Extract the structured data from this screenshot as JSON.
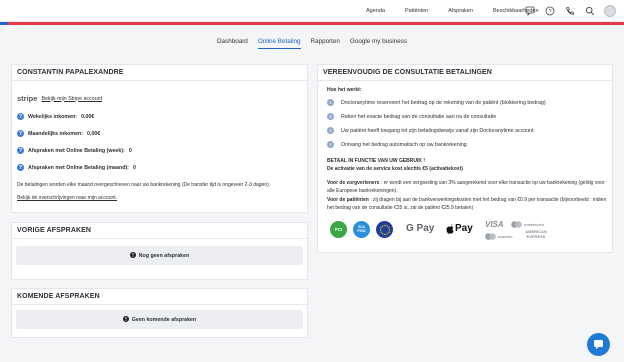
{
  "topnav": [
    "Agenda",
    "Patiënten",
    "Afspraken",
    "Beschikbaarheden"
  ],
  "tabs": [
    {
      "label": "Dashboard",
      "active": false
    },
    {
      "label": "Online Betaling",
      "active": true
    },
    {
      "label": "Rapporten",
      "active": false
    },
    {
      "label": "Google my business",
      "active": false
    }
  ],
  "account": {
    "name": "CONSTANTIN PAPALEXANDRE",
    "stripe_logo": "stripe",
    "stripe_link": "Bekijk mijn Stripe account",
    "stats": [
      {
        "label": "Wekelijks inkomen:",
        "value": "0,00€"
      },
      {
        "label": "Maandelijks inkomen:",
        "value": "0,00€"
      },
      {
        "label": "Afspraken met Online Betaling (week):",
        "value": "0"
      },
      {
        "label": "Afspraken met Online Betaling (maand):",
        "value": "0"
      }
    ],
    "note": "De betalingen worden elke maand overgeschreven naar uw bankrekening (De transfer tijd is ongeveer 2-3 dagen).",
    "transfers_link": "Bekijk de overschrijvingen naar mijn account."
  },
  "previous": {
    "title": "VORIGE AFSPRAKEN",
    "empty": "Nog geen afspraken"
  },
  "upcoming": {
    "title": "KOMENDE AFSPRAKEN",
    "empty": "Geen komende afspraken"
  },
  "info": {
    "title": "VEREENVOUDIG DE CONSULTATIE BETALINGEN",
    "how_title": "Hoe het werkt:",
    "steps": [
      "Doctoranytime reserveert het bedrag op de rekening van de patiënt (blokkering bedrag)",
      "Reken het exacte bedrag van de consultatie aan na de consultatie",
      "Uw patiënt heeft toegang tot zijn betalingsbewijs vanaf zijn Doctoranytime account",
      "Ontvang het bedrag automatisch op uw bankrekening"
    ],
    "pay_title": "BETAAL IN FUNCTIE VAN UW GEBRUIK !",
    "activation": "De activatie van de service kost slechts €5 (activatiekost)",
    "pros_label": "Voor de zorgverleners",
    "pros_text": ": er wordt een vergoeding van 3% aangerekend voor elke transactie op uw bankrekening (geldig voor alle Europese bankrekeningen).",
    "patients_label": "Voor de patiënten",
    "patients_text": ": zij dragen bij aan de bankverwerkingskosten met het bedrag van €0.9 per transactie (bijvoorbeeld : indien het bedrag van de consultatie €25 is, zal de patiënt €25.9 betalen)",
    "badges": [
      "PCI",
      "SCA PSD2",
      "EU"
    ],
    "gpay": "G Pay",
    "apay": "Pay",
    "cards": [
      "VISA",
      "mastercard",
      "maestro",
      "AMERICAN EXPRESS"
    ]
  }
}
